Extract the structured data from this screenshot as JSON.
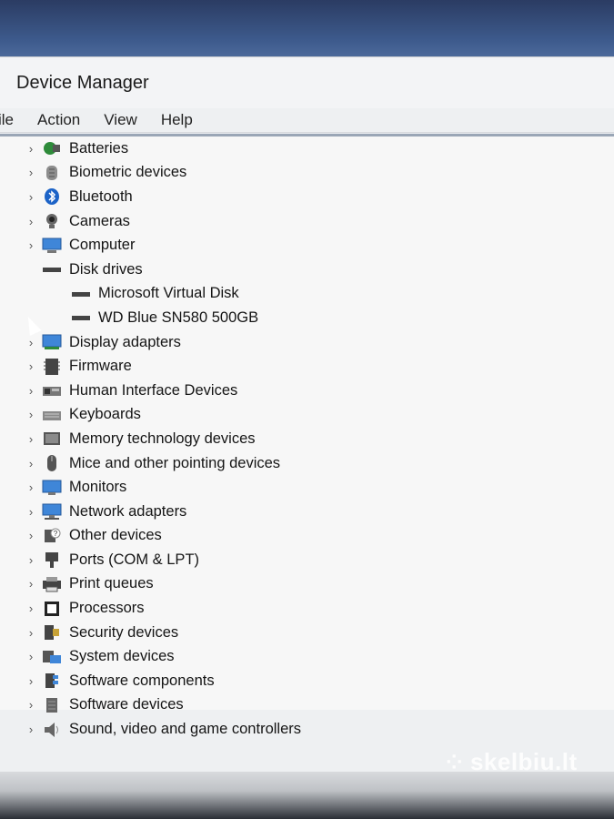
{
  "window": {
    "title": "Device Manager"
  },
  "menu": [
    "ile",
    "Action",
    "View",
    "Help"
  ],
  "toolbar": {
    "icons": [
      "back-arrow-icon",
      "forward-arrow-icon",
      "properties-icon",
      "help-icon",
      "run-icon",
      "update-driver-icon",
      "scan-hardware-icon"
    ]
  },
  "tree": [
    {
      "label": "Batteries",
      "expanded": false,
      "icon": "battery-icon"
    },
    {
      "label": "Biometric devices",
      "expanded": false,
      "icon": "fingerprint-icon"
    },
    {
      "label": "Bluetooth",
      "expanded": false,
      "icon": "bluetooth-icon"
    },
    {
      "label": "Cameras",
      "expanded": false,
      "icon": "camera-icon"
    },
    {
      "label": "Computer",
      "expanded": false,
      "icon": "computer-icon"
    },
    {
      "label": "Disk drives",
      "expanded": true,
      "icon": "disk-drive-icon"
    },
    {
      "label": "Microsoft Virtual Disk",
      "child": true,
      "icon": "disk-drive-icon"
    },
    {
      "label": "WD Blue SN580 500GB",
      "child": true,
      "icon": "disk-drive-icon"
    },
    {
      "label": "Display adapters",
      "expanded": false,
      "icon": "display-adapter-icon"
    },
    {
      "label": "Firmware",
      "expanded": false,
      "icon": "firmware-icon"
    },
    {
      "label": "Human Interface Devices",
      "expanded": false,
      "icon": "hid-icon"
    },
    {
      "label": "Keyboards",
      "expanded": false,
      "icon": "keyboard-icon"
    },
    {
      "label": "Memory technology devices",
      "expanded": false,
      "icon": "memory-icon"
    },
    {
      "label": "Mice and other pointing devices",
      "expanded": false,
      "icon": "mouse-icon"
    },
    {
      "label": "Monitors",
      "expanded": false,
      "icon": "monitor-icon"
    },
    {
      "label": "Network adapters",
      "expanded": false,
      "icon": "network-icon"
    },
    {
      "label": "Other devices",
      "expanded": false,
      "icon": "unknown-device-icon"
    },
    {
      "label": "Ports (COM & LPT)",
      "expanded": false,
      "icon": "port-icon"
    },
    {
      "label": "Print queues",
      "expanded": false,
      "icon": "printer-icon"
    },
    {
      "label": "Processors",
      "expanded": false,
      "icon": "processor-icon"
    },
    {
      "label": "Security devices",
      "expanded": false,
      "icon": "security-icon"
    },
    {
      "label": "System devices",
      "expanded": false,
      "icon": "system-icon"
    },
    {
      "label": "Software components",
      "expanded": false,
      "icon": "software-component-icon"
    },
    {
      "label": "Software devices",
      "expanded": false,
      "icon": "software-device-icon"
    },
    {
      "label": "Sound, video and game controllers",
      "expanded": false,
      "icon": "sound-icon"
    }
  ],
  "watermark": "skelbiu.lt",
  "colors": {
    "accent": "#1a6fd1",
    "window_bg": "#eef0f2",
    "tree_bg": "#f7f7f7"
  }
}
